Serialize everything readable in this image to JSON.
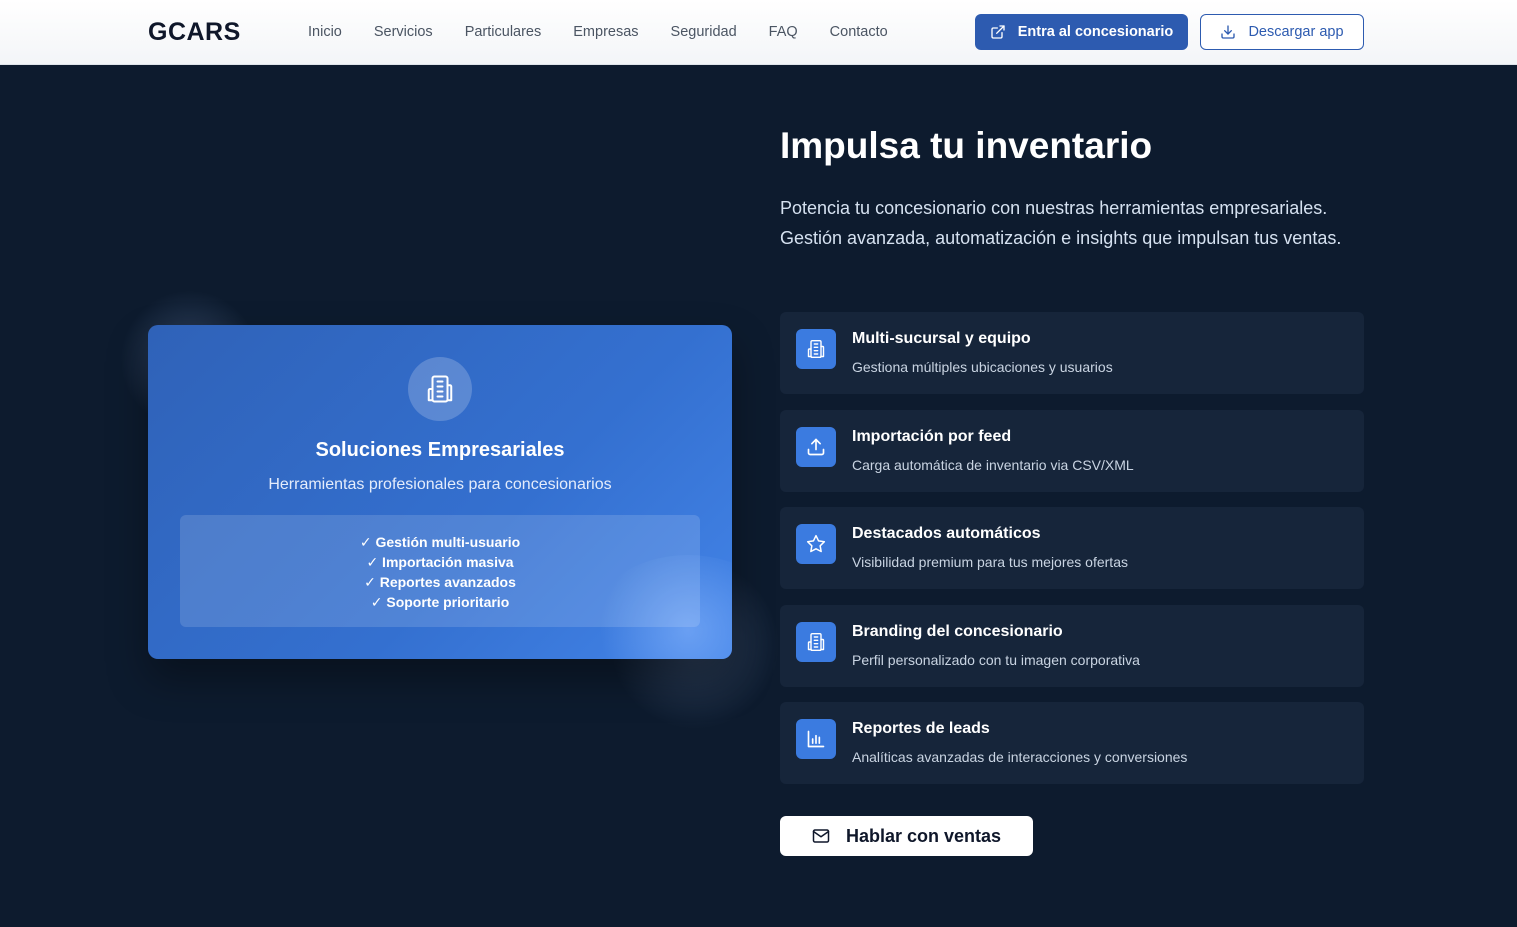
{
  "header": {
    "logo": "GCARS",
    "nav": [
      "Inicio",
      "Servicios",
      "Particulares",
      "Empresas",
      "Seguridad",
      "FAQ",
      "Contacto"
    ],
    "primary_button": "Entra al concesionario",
    "outline_button": "Descargar app"
  },
  "feature_card": {
    "icon": "building-icon",
    "title": "Soluciones Empresariales",
    "subtitle": "Herramientas profesionales para concesionarios",
    "checklist": [
      "✓ Gestión multi-usuario",
      "✓ Importación masiva",
      "✓ Reportes avanzados",
      "✓ Soporte prioritario"
    ]
  },
  "hero": {
    "title": "Impulsa tu inventario",
    "description": "Potencia tu concesionario con nuestras herramientas empresariales. Gestión avanzada, automatización e insights que impulsan tus ventas."
  },
  "features": [
    {
      "icon": "building-icon",
      "title": "Multi-sucursal y equipo",
      "desc": "Gestiona múltiples ubicaciones y usuarios"
    },
    {
      "icon": "upload-icon",
      "title": "Importación por feed",
      "desc": "Carga automática de inventario via CSV/XML"
    },
    {
      "icon": "star-icon",
      "title": "Destacados automáticos",
      "desc": "Visibilidad premium para tus mejores ofertas"
    },
    {
      "icon": "building-icon",
      "title": "Branding del concesionario",
      "desc": "Perfil personalizado con tu imagen corporativa"
    },
    {
      "icon": "bar-chart-icon",
      "title": "Reportes de leads",
      "desc": "Analíticas avanzadas de interacciones y conversiones"
    }
  ],
  "cta": {
    "label": "Hablar con ventas",
    "icon": "mail-icon"
  },
  "colors": {
    "background": "#0d1b2e",
    "accent": "#3b7be0",
    "primary_button": "#2d5bb0",
    "card": "#16253a"
  }
}
